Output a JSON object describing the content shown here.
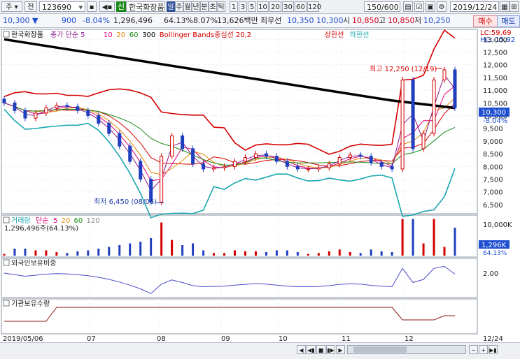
{
  "toolbar": {
    "menu1": "주",
    "menu2": "전",
    "code": "123690",
    "sound_icon": "speaker-icon",
    "credit_badge": "신",
    "stock_name": "한국화장품",
    "period_buttons": [
      "일",
      "주",
      "월",
      "년",
      "분",
      "초",
      "틱"
    ],
    "active_period": "일",
    "interval_buttons": [
      "1",
      "3",
      "5",
      "10",
      "20",
      "30",
      "60",
      "120"
    ],
    "count": "150",
    "count_total": "/600",
    "date": "2019/12/24"
  },
  "quote": {
    "price": "10,300",
    "change": "900",
    "change_pct": "-8.04%",
    "volume": "1,296,496",
    "volume_ratio": "64.13%",
    "turnover_ratio": "8.07%",
    "amount": "13,626백만",
    "ask_label": "최우선",
    "ask": "10,350",
    "bid": "10,300",
    "open_label": "시",
    "open": "10,850",
    "high_label": "고",
    "high": "10,850",
    "low_label": "저",
    "low": "10,250",
    "sell_label": "매수",
    "buy_label": "매도"
  },
  "price_panel": {
    "legend": [
      "한국화장품",
      "종가 단순 5",
      "10",
      "20",
      "60",
      "300",
      "Bollinger Bands중심선 20,2",
      "상한선",
      "하한선"
    ],
    "legend_colors": [
      "#000000",
      "#8b1a8b",
      "#e0007a",
      "#e08a00",
      "#1a8a1a",
      "#000000",
      "#d40000",
      "#d40000",
      "#1aa6b0"
    ],
    "lc_label": "LC:59,69",
    "hc_label": "HC:-15,92",
    "high_annotation": "최고 12,250 (12/19)",
    "low_annotation": "최저 6,450 (08/06)",
    "current_tag": "10,300",
    "current_pct": "-8.04%",
    "y_ticks": [
      "13,000",
      "12,500",
      "12,000",
      "11,500",
      "11,000",
      "10,500",
      "10,000",
      "9,500",
      "9,000",
      "8,500",
      "8,000",
      "7,500",
      "7,000",
      "6,500"
    ]
  },
  "volume_panel": {
    "legend": [
      "거래량",
      "단순",
      "5",
      "20",
      "60",
      "120"
    ],
    "legend_colors": [
      "#1aa6b0",
      "#e0007a",
      "#e0007a",
      "#e08a00",
      "#1a8a1a",
      "#8b8b8b"
    ],
    "value_label": "1,296,496주(64.13%)",
    "y_tick": "10,000K",
    "current_tag": "1,296K",
    "current_pct": "64.13%"
  },
  "foreign_panel": {
    "title": "외국인보유비중",
    "y_tick": "2.00"
  },
  "inst_panel": {
    "title": "기관보유수량"
  },
  "x_axis": {
    "labels": [
      "2019/05/06",
      "07",
      "08",
      "09",
      "10",
      "11",
      "12"
    ],
    "end_label": "12/24"
  },
  "chart_data": {
    "type": "candlestick",
    "x_range": [
      "2019/05/06",
      "2019/12/24"
    ],
    "y_range": [
      6450,
      13000
    ],
    "ohlc_summary": {
      "last_close": 10300,
      "period_high": 12250,
      "period_high_date": "12/19",
      "period_low": 6450,
      "period_low_date": "08/06"
    },
    "closes": [
      10500,
      10200,
      9900,
      10100,
      10300,
      10400,
      10350,
      10200,
      10000,
      9700,
      9300,
      8800,
      8200,
      7500,
      6600,
      8400,
      9200,
      8700,
      8100,
      7900,
      7950,
      8000,
      8200,
      8350,
      8500,
      8400,
      8200,
      8000,
      7900,
      7900,
      7950,
      8100,
      8350,
      8450,
      8400,
      8150,
      8000,
      7900,
      11400,
      8700,
      9300,
      11400,
      11800,
      10300
    ],
    "series": [
      {
        "name": "300",
        "values": [
          13000,
          12600,
          12200,
          11800,
          11400,
          11000,
          10600,
          10300
        ]
      }
    ]
  }
}
